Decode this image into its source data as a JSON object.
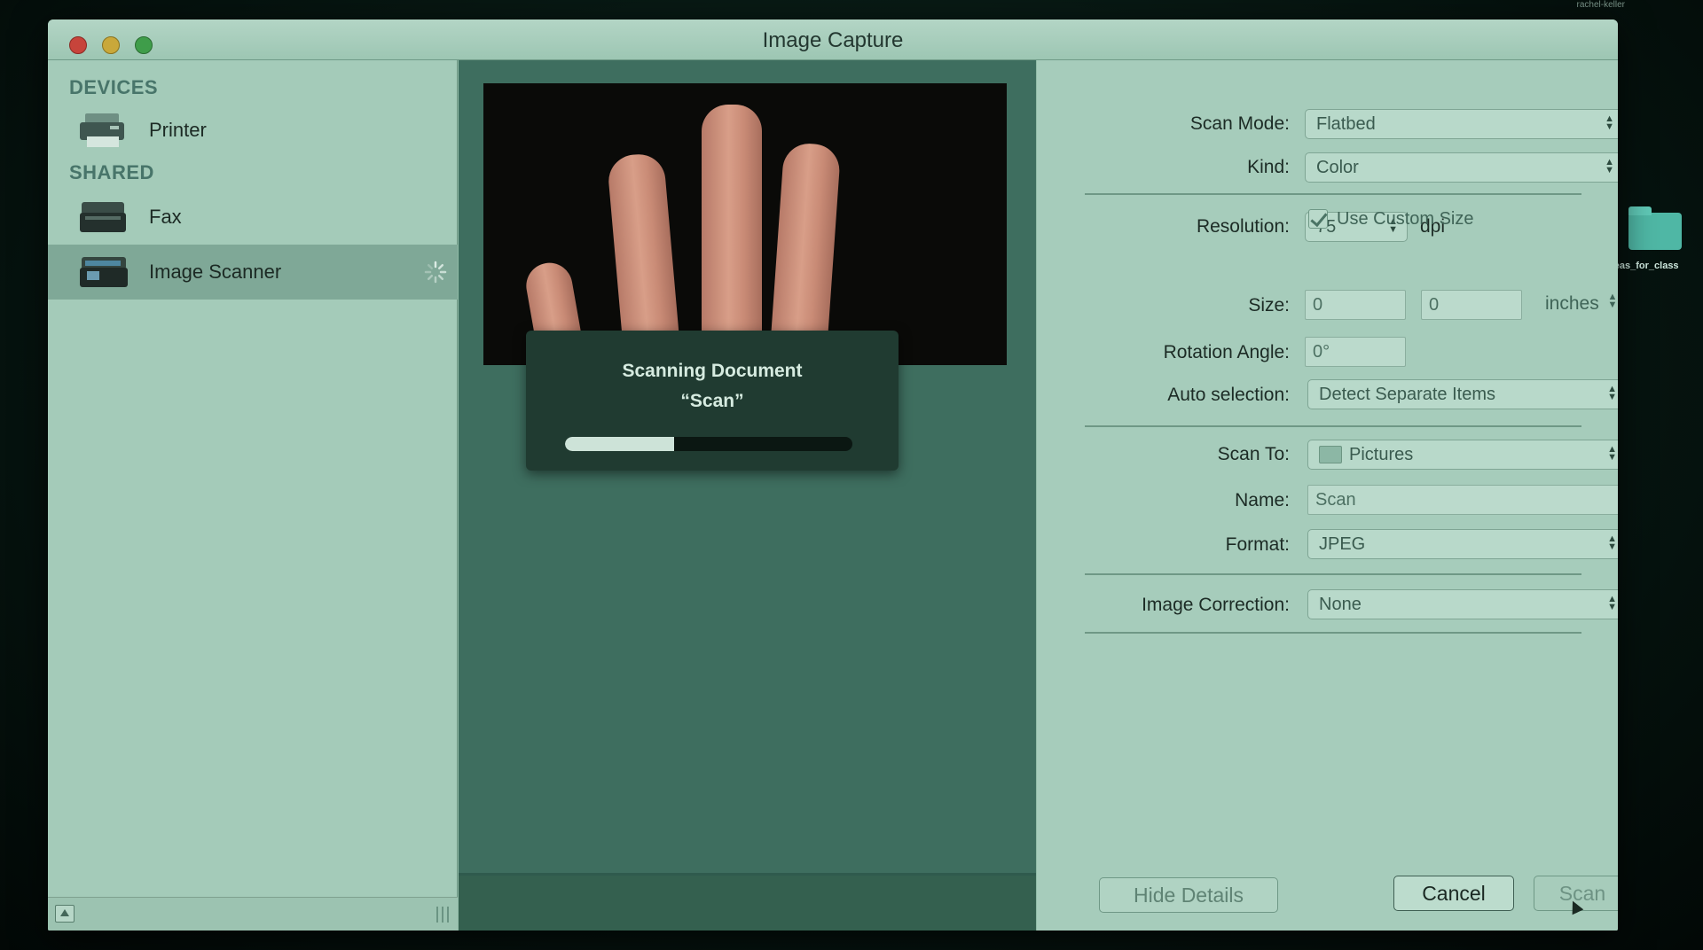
{
  "desktop": {
    "top_label": "rachel-keller",
    "folder_label": "ideas_for_class"
  },
  "window": {
    "title": "Image Capture"
  },
  "sidebar": {
    "sections": [
      {
        "label": "DEVICES"
      },
      {
        "label": "SHARED"
      }
    ],
    "items": [
      {
        "label": "Printer",
        "icon": "printer-icon"
      },
      {
        "label": "Fax",
        "icon": "fax-icon"
      },
      {
        "label": "Image Scanner",
        "icon": "scanner-icon",
        "selected": true,
        "busy": true
      }
    ]
  },
  "progress": {
    "title": "Scanning Document",
    "subtitle": "“Scan”",
    "fraction": 0.38
  },
  "settings": {
    "scan_mode": {
      "label": "Scan Mode:",
      "value": "Flatbed"
    },
    "kind": {
      "label": "Kind:",
      "value": "Color"
    },
    "resolution": {
      "label": "Resolution:",
      "value": "75",
      "unit": "dpi"
    },
    "custom_size": {
      "label": "Use Custom Size",
      "checked": true
    },
    "size": {
      "label": "Size:",
      "width": "0",
      "height": "0",
      "unit": "inches"
    },
    "rotation": {
      "label": "Rotation Angle:",
      "value": "0°"
    },
    "auto_selection": {
      "label": "Auto selection:",
      "value": "Detect Separate Items"
    },
    "scan_to": {
      "label": "Scan To:",
      "value": "Pictures"
    },
    "name": {
      "label": "Name:",
      "value": "Scan"
    },
    "format": {
      "label": "Format:",
      "value": "JPEG"
    },
    "image_correction": {
      "label": "Image Correction:",
      "value": "None"
    }
  },
  "buttons": {
    "hide_details": "Hide Details",
    "cancel": "Cancel",
    "scan": "Scan"
  }
}
